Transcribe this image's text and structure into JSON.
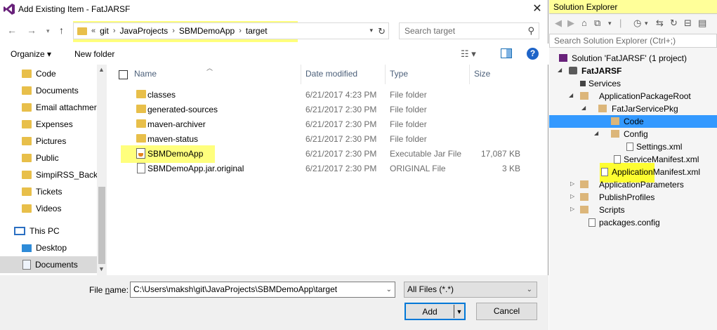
{
  "dialog": {
    "title": "Add Existing Item - FatJARSF",
    "close_glyph": "✕",
    "breadcrumbs": [
      "git",
      "JavaProjects",
      "SBMDemoApp",
      "target"
    ],
    "overflow_glyph": "«",
    "search_placeholder": "Search target",
    "organize_label": "Organize ▾",
    "new_folder_label": "New folder",
    "help_glyph": "?"
  },
  "nav": {
    "items": [
      {
        "label": "Code",
        "icon": "folder-icon"
      },
      {
        "label": "Documents",
        "icon": "folder-icon"
      },
      {
        "label": "Email attachmer",
        "icon": "folder-icon"
      },
      {
        "label": "Expenses",
        "icon": "folder-icon"
      },
      {
        "label": "Pictures",
        "icon": "folder-icon"
      },
      {
        "label": "Public",
        "icon": "folder-icon"
      },
      {
        "label": "SimpiRSS_Backu",
        "icon": "folder-icon"
      },
      {
        "label": "Tickets",
        "icon": "folder-icon"
      },
      {
        "label": "Videos",
        "icon": "folder-icon"
      },
      {
        "label": "This PC",
        "icon": "computer-icon"
      },
      {
        "label": "Desktop",
        "icon": "desktop-icon"
      },
      {
        "label": "Documents",
        "icon": "documents-icon"
      }
    ]
  },
  "columns": {
    "name": "Name",
    "date": "Date modified",
    "type": "Type",
    "size": "Size"
  },
  "files": [
    {
      "name": "classes",
      "date": "6/21/2017 4:23 PM",
      "type": "File folder",
      "size": "",
      "kind": "folder"
    },
    {
      "name": "generated-sources",
      "date": "6/21/2017 2:30 PM",
      "type": "File folder",
      "size": "",
      "kind": "folder"
    },
    {
      "name": "maven-archiver",
      "date": "6/21/2017 2:30 PM",
      "type": "File folder",
      "size": "",
      "kind": "folder"
    },
    {
      "name": "maven-status",
      "date": "6/21/2017 2:30 PM",
      "type": "File folder",
      "size": "",
      "kind": "folder"
    },
    {
      "name": "SBMDemoApp",
      "date": "6/21/2017 2:30 PM",
      "type": "Executable Jar File",
      "size": "17,087 KB",
      "kind": "jar"
    },
    {
      "name": "SBMDemoApp.jar.original",
      "date": "6/21/2017 2:30 PM",
      "type": "ORIGINAL File",
      "size": "3 KB",
      "kind": "file"
    }
  ],
  "bottom": {
    "file_name_label_pre": "File ",
    "file_name_label_u": "n",
    "file_name_label_post": "ame:",
    "file_name_value": "C:\\Users\\maksh\\git\\JavaProjects\\SBMDemoApp\\target",
    "filter_value": "All Files (*.*)",
    "add_label": "Add",
    "cancel_label": "Cancel"
  },
  "solution_explorer": {
    "title": "Solution Explorer",
    "search_placeholder": "Search Solution Explorer (Ctrl+;)",
    "tree": [
      {
        "label": "Solution 'FatJARSF' (1 project)",
        "icon": "solution-icon",
        "depth": 0,
        "arrow": ""
      },
      {
        "label": "FatJARSF",
        "icon": "app-icon",
        "depth": 1,
        "arrow": "◢",
        "bold": true
      },
      {
        "label": "Services",
        "icon": "services-icon",
        "depth": 2,
        "arrow": ""
      },
      {
        "label": "ApplicationPackageRoot",
        "icon": "folder-icon",
        "depth": 2,
        "arrow": "◢"
      },
      {
        "label": "FatJarServicePkg",
        "icon": "folder-icon",
        "depth": 3,
        "arrow": "◢"
      },
      {
        "label": "Code",
        "icon": "folder-icon",
        "depth": 4,
        "arrow": "",
        "selected": true
      },
      {
        "label": "Config",
        "icon": "folder-icon",
        "depth": 4,
        "arrow": "◢"
      },
      {
        "label": "Settings.xml",
        "icon": "xml-icon",
        "depth": 5,
        "arrow": ""
      },
      {
        "label": "ServiceManifest.xml",
        "icon": "xml-icon",
        "depth": 4,
        "arrow": ""
      },
      {
        "label": "ApplicationManifest.xml",
        "icon": "xml-icon",
        "depth": 3,
        "arrow": ""
      },
      {
        "label": "ApplicationParameters",
        "icon": "folder-icon",
        "depth": 2,
        "arrow": "▷"
      },
      {
        "label": "PublishProfiles",
        "icon": "folder-icon",
        "depth": 2,
        "arrow": "▷"
      },
      {
        "label": "Scripts",
        "icon": "folder-icon",
        "depth": 2,
        "arrow": "▷"
      },
      {
        "label": "packages.config",
        "icon": "xml-icon",
        "depth": 2,
        "arrow": ""
      }
    ]
  },
  "colors": {
    "highlight": "#ffff66",
    "accent": "#0078d7",
    "selection": "#3399ff"
  }
}
